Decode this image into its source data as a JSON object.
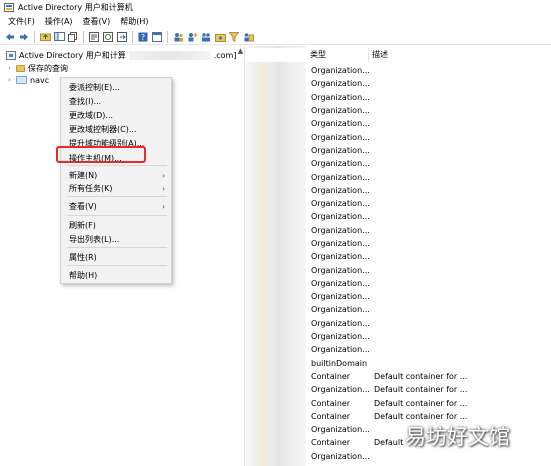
{
  "window": {
    "title": "Active Directory 用户和计算机"
  },
  "menubar": {
    "items": [
      "文件(F)",
      "操作(A)",
      "查看(V)",
      "帮助(H)"
    ]
  },
  "toolbar": {
    "icons": [
      "back-arrow",
      "forward-arrow",
      "up-folder",
      "console-tree",
      "copy",
      "properties",
      "refresh",
      "export-list",
      "help",
      "show-console",
      "users",
      "add-user",
      "add-group",
      "add-ou",
      "filter",
      "add-to-group"
    ]
  },
  "tree": {
    "root_label": "Active Directory 用户和计算",
    "root_suffix": ".com]",
    "saved_queries": "保存的查询",
    "domain_label": "navc"
  },
  "list": {
    "columns": [
      "类型",
      "描述"
    ],
    "rows": [
      {
        "type": "Organization...",
        "desc": ""
      },
      {
        "type": "Organization...",
        "desc": ""
      },
      {
        "type": "Organization...",
        "desc": ""
      },
      {
        "type": "Organization...",
        "desc": ""
      },
      {
        "type": "Organization...",
        "desc": ""
      },
      {
        "type": "Organization...",
        "desc": ""
      },
      {
        "type": "Organization...",
        "desc": ""
      },
      {
        "type": "Organization...",
        "desc": ""
      },
      {
        "type": "Organization...",
        "desc": ""
      },
      {
        "type": "Organization...",
        "desc": ""
      },
      {
        "type": "Organization...",
        "desc": ""
      },
      {
        "type": "Organization...",
        "desc": ""
      },
      {
        "type": "Organization...",
        "desc": ""
      },
      {
        "type": "Organization...",
        "desc": ""
      },
      {
        "type": "Organization...",
        "desc": ""
      },
      {
        "type": "Organization...",
        "desc": ""
      },
      {
        "type": "Organization...",
        "desc": ""
      },
      {
        "type": "Organization...",
        "desc": ""
      },
      {
        "type": "Organization...",
        "desc": ""
      },
      {
        "type": "Organization...",
        "desc": ""
      },
      {
        "type": "Organization...",
        "desc": ""
      },
      {
        "type": "Organization...",
        "desc": ""
      },
      {
        "type": "builtinDomain",
        "desc": ""
      },
      {
        "type": "Container",
        "desc": "Default container for ..."
      },
      {
        "type": "Organization...",
        "desc": "Default container for ..."
      },
      {
        "type": "Container",
        "desc": "Default container for ..."
      },
      {
        "type": "Container",
        "desc": "Default container for ..."
      },
      {
        "type": "Organization...",
        "desc": ""
      },
      {
        "type": "Container",
        "desc": "Default"
      },
      {
        "type": "Organization...",
        "desc": ""
      }
    ]
  },
  "context_menu": {
    "items": [
      {
        "label": "委派控制(E)...",
        "submenu": false
      },
      {
        "label": "查找(I)...",
        "submenu": false
      },
      {
        "label": "更改域(D)...",
        "submenu": false
      },
      {
        "label": "更改域控制器(C)...",
        "submenu": false
      },
      {
        "label": "提升域功能级别(A)...",
        "submenu": false
      },
      {
        "label": "操作主机(M)...",
        "submenu": false
      },
      {
        "label": "新建(N)",
        "submenu": true
      },
      {
        "label": "所有任务(K)",
        "submenu": true
      },
      {
        "label": "查看(V)",
        "submenu": true
      },
      {
        "label": "刷新(F)",
        "submenu": false
      },
      {
        "label": "导出列表(L)...",
        "submenu": false
      },
      {
        "label": "属性(R)",
        "submenu": false
      },
      {
        "label": "帮助(H)",
        "submenu": false
      }
    ],
    "highlighted_item": "操作主机(M)..."
  },
  "colors": {
    "highlight_border": "#e8282a",
    "folder": "#e7c566",
    "menu_bg": "#f2f2f2"
  },
  "watermark": {
    "text": "易坊好文馆"
  }
}
